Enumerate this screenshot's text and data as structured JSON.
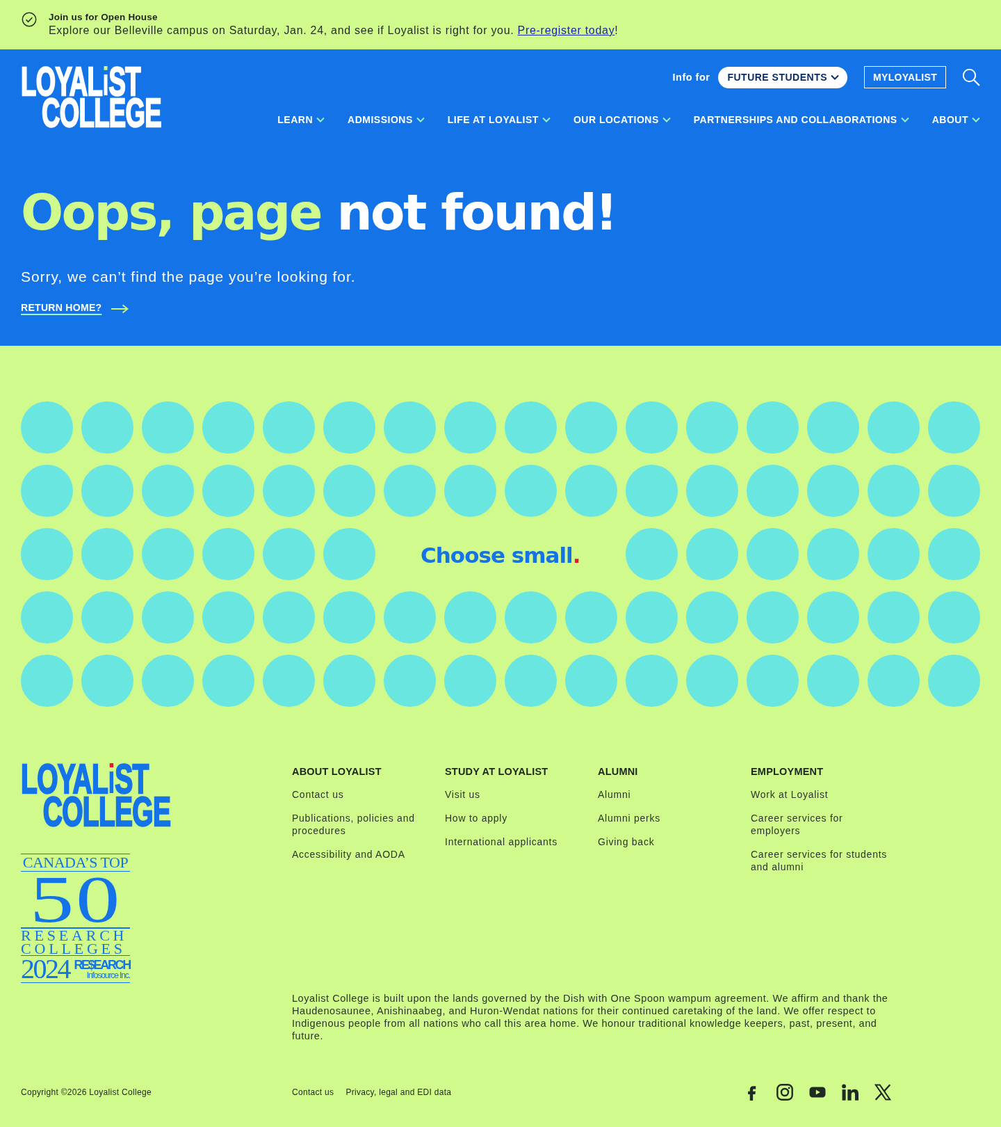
{
  "announcement": {
    "title": "Join us for Open House",
    "text": "Explore our Belleville campus on Saturday, Jan. 24, and see if Loyalist is right for you.",
    "link": "Pre-register today",
    "text_end": "!"
  },
  "header": {
    "logo": {
      "start": "LOYAL",
      "dotted_letter": "i",
      "end": "ST",
      "line_2": "COLLEGE"
    },
    "info_for": "Info for",
    "audience_menu": "FUTURE STUDENTS",
    "portal_button": "MYLOYALIST",
    "nav": [
      "LEARN",
      "ADMISSIONS",
      "LIFE AT LOYALIST",
      "OUR LOCATIONS",
      "PARTNERSHIPS AND COLLABORATIONS",
      "ABOUT"
    ]
  },
  "hero": {
    "title_highlight": "Oops, page",
    "title_rest": "not found!",
    "message": "Sorry, we can’t find the page you’re looking for.",
    "return_link": "RETURN HOME?"
  },
  "pattern": {
    "tagline": "Choose small",
    "tagline_mark": "."
  },
  "footer": {
    "logo": {
      "start": "LOYAL",
      "dotted_letter": "i",
      "end": "ST",
      "line_2": "COLLEGE"
    },
    "award": {
      "title": "CANADA’S TOP",
      "number": "50",
      "lines": [
        "RESEARCH",
        "COLLEGES"
      ],
      "year": "2024",
      "publisher": "RE$EARCH",
      "publisher_sub": "Infosource Inc."
    },
    "columns": [
      {
        "heading": "ABOUT LOYALIST",
        "links": [
          "Contact us",
          "Publications, policies and procedures",
          "Accessibility and AODA"
        ]
      },
      {
        "heading": "STUDY AT LOYALIST",
        "links": [
          "Visit us",
          "How to apply",
          "International applicants"
        ]
      },
      {
        "heading": "ALUMNI",
        "links": [
          "Alumni",
          "Alumni perks",
          "Giving back"
        ]
      },
      {
        "heading": "EMPLOYMENT",
        "links": [
          "Work at Loyalist",
          "Career services for employers",
          "Career services for students and alumni"
        ]
      }
    ],
    "acknowledgement": "Loyalist College is built upon the lands governed by the Dish with One Spoon wampum agreement. We affirm and thank the Haudenosaunee, Anishinaabeg, and Huron-Wendat nations for their continued caretaking of the land. We offer respect to Indigenous people from all nations who call this area home. We honour traditional knowledge keepers, past, present, and future.",
    "copyright": "Copyright ©2026 Loyalist College",
    "legal_links": [
      "Contact us",
      "Privacy, legal and EDI data"
    ]
  }
}
